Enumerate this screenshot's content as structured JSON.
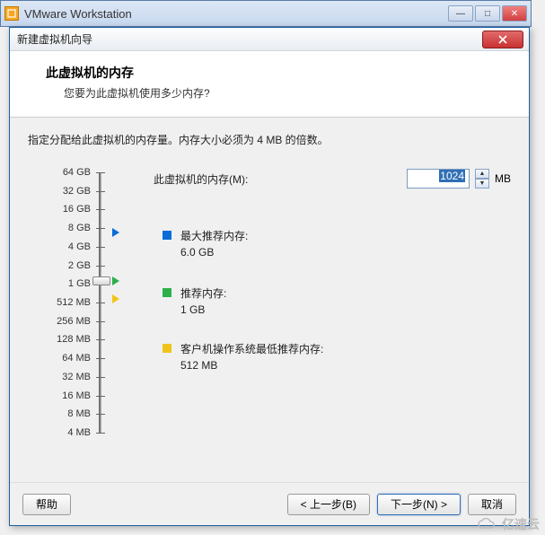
{
  "vmware": {
    "title": "VMware Workstation",
    "controls": {
      "min": "—",
      "max": "□",
      "close": "✕"
    }
  },
  "wizard": {
    "title": "新建虚拟机向导",
    "header": {
      "title": "此虚拟机的内存",
      "subtitle": "您要为此虚拟机使用多少内存?"
    },
    "instruction": "指定分配给此虚拟机的内存量。内存大小必须为 4 MB 的倍数。",
    "memory": {
      "label": "此虚拟机的内存(M):",
      "value": "1024",
      "unit": "MB"
    },
    "ticks": [
      "64 GB",
      "32 GB",
      "16 GB",
      "8 GB",
      "4 GB",
      "2 GB",
      "1 GB",
      "512 MB",
      "256 MB",
      "128 MB",
      "64 MB",
      "32 MB",
      "16 MB",
      "8 MB",
      "4 MB"
    ],
    "legend": {
      "max": {
        "label": "最大推荐内存:",
        "value": "6.0 GB"
      },
      "rec": {
        "label": "推荐内存:",
        "value": "1 GB"
      },
      "min": {
        "label": "客户机操作系统最低推荐内存:",
        "value": "512 MB"
      }
    },
    "buttons": {
      "help": "帮助",
      "back": "< 上一步(B)",
      "next": "下一步(N) >",
      "cancel": "取消"
    }
  },
  "watermark": "亿速云"
}
